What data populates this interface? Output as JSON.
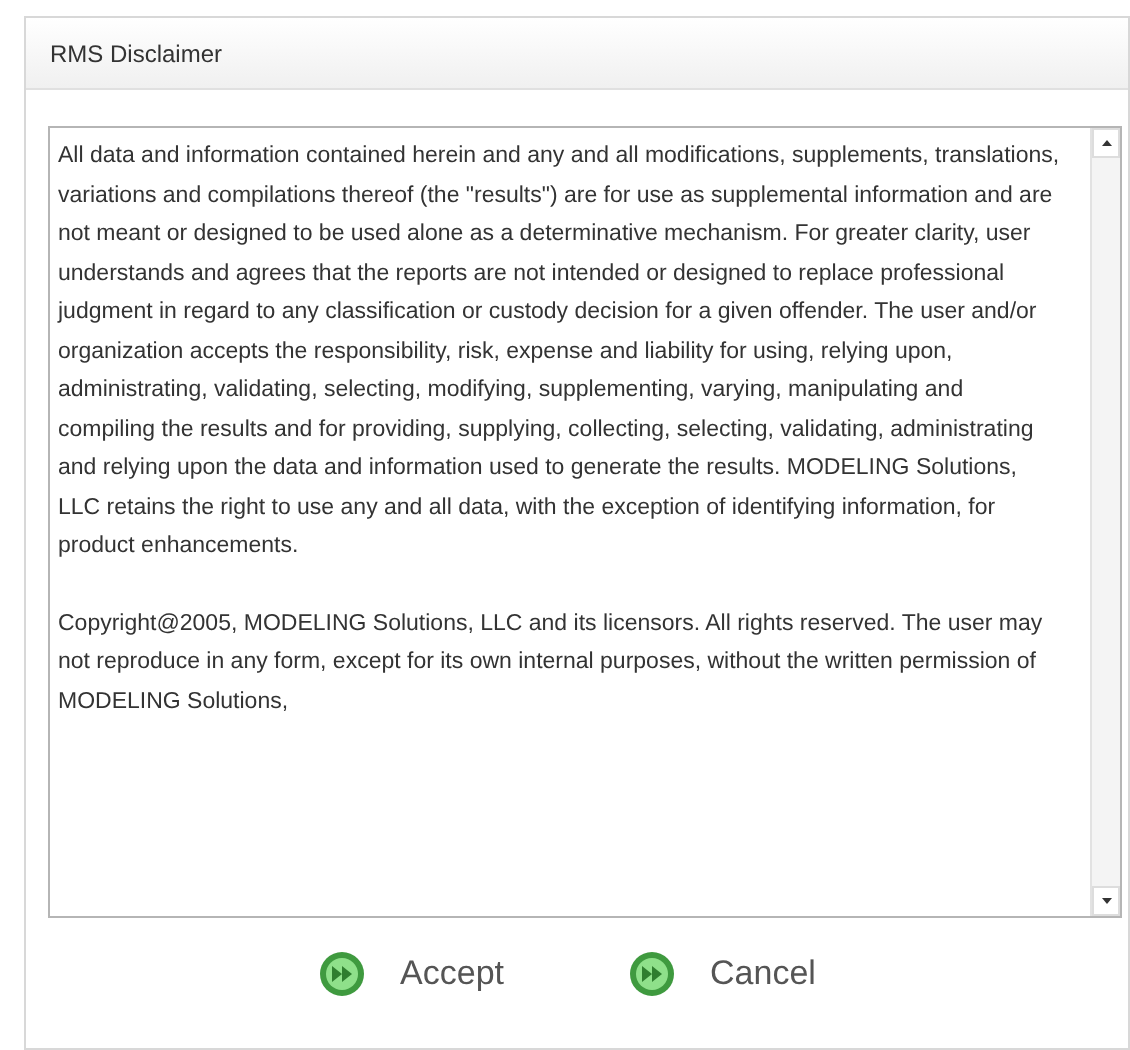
{
  "window": {
    "title": "RMS Disclaimer"
  },
  "disclaimer": {
    "paragraphs": [
      "All data and information contained herein and any and all modifications, supplements, translations, variations and compilations thereof (the \"results\") are for use as supplemental information and are not meant or designed to be used alone as a determinative mechanism. For greater clarity, user understands and agrees that the reports are not intended or designed to replace professional judgment in regard to any classification or custody decision for a given offender.  The user and/or organization accepts the responsibility, risk, expense and liability for using, relying upon, administrating, validating, selecting, modifying, supplementing, varying, manipulating and compiling the results and for providing, supplying, collecting, selecting, validating, administrating and relying upon the data and information used to generate the results.  MODELING Solutions, LLC retains the right to use any and all data, with the exception of identifying information, for product enhancements.",
      "Copyright@2005, MODELING Solutions, LLC and its licensors.  All rights reserved.  The user may not reproduce in any form, except for its own internal purposes, without the written permission of MODELING Solutions,"
    ]
  },
  "buttons": [
    "Accept",
    "Cancel"
  ]
}
